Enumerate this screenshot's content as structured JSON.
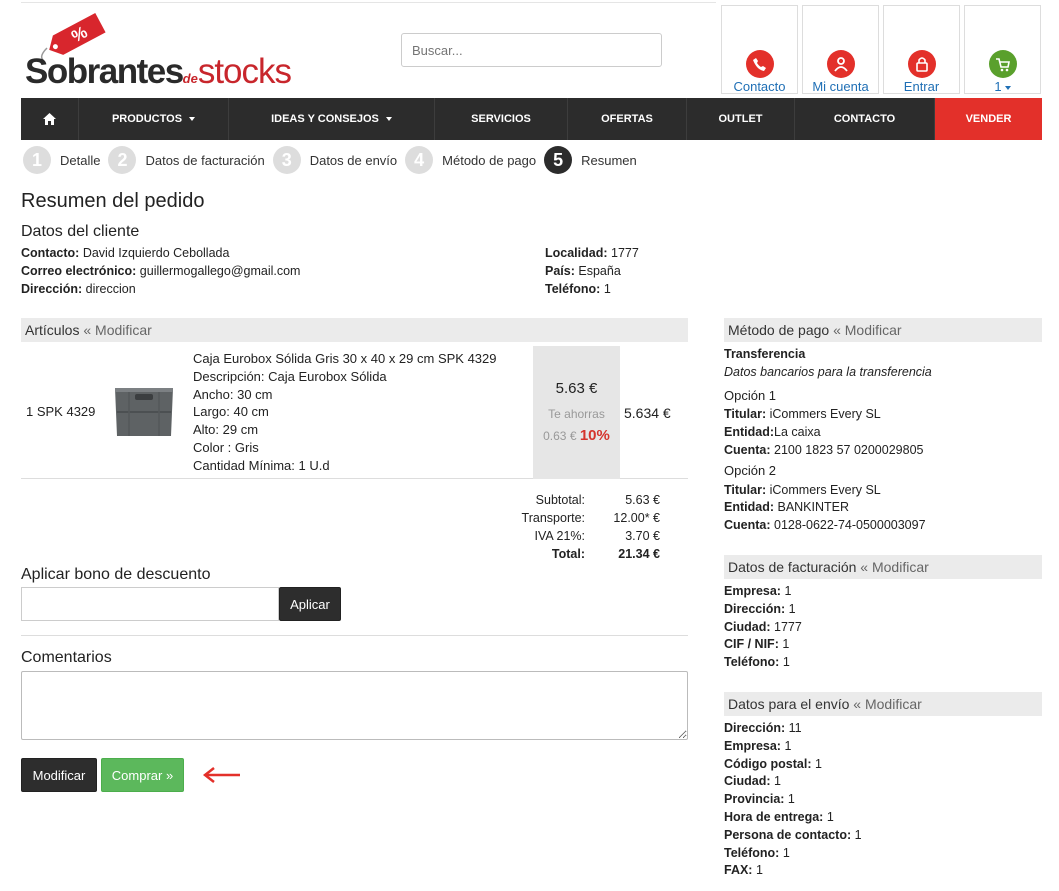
{
  "header": {
    "logo_text_main": "Sobrantes",
    "logo_text_de": "de",
    "logo_text_end": "stocks",
    "logo_tag_symbol": "%",
    "search_placeholder": "Buscar...",
    "quick_links": [
      {
        "label": "Contacto",
        "icon": "phone-icon",
        "color": "#e3302a"
      },
      {
        "label": "Mi cuenta",
        "icon": "user-icon",
        "color": "#e3302a"
      },
      {
        "label": "Entrar",
        "icon": "lock-icon",
        "color": "#e3302a"
      },
      {
        "label": "1",
        "icon": "cart-icon",
        "color": "#5aa02c"
      }
    ]
  },
  "nav": {
    "items": [
      "PRODUCTOS",
      "IDEAS Y CONSEJOS",
      "SERVICIOS",
      "OFERTAS",
      "OUTLET",
      "CONTACTO",
      "VENDER"
    ]
  },
  "steps": [
    {
      "num": "1",
      "label": "Detalle"
    },
    {
      "num": "2",
      "label": "Datos de facturación"
    },
    {
      "num": "3",
      "label": "Datos de envío"
    },
    {
      "num": "4",
      "label": "Método de pago"
    },
    {
      "num": "5",
      "label": "Resumen"
    }
  ],
  "page_title": "Resumen del pedido",
  "customer": {
    "heading": "Datos del cliente",
    "contacto_label": "Contacto:",
    "contacto": "David Izquierdo Cebollada",
    "correo_label": "Correo electrónico:",
    "correo": "guillermogallego@gmail.com",
    "direccion_label": "Dirección:",
    "direccion": "direccion",
    "localidad_label": "Localidad:",
    "localidad": "1777",
    "pais_label": "País:",
    "pais": "España",
    "telefono_label": "Teléfono:",
    "telefono": "1"
  },
  "articles": {
    "heading": "Artículos",
    "modify": "« Modificar",
    "item": {
      "qty_ref": "1  SPK 4329",
      "name": "Caja Eurobox Sólida Gris 30 x 40 x 29 cm SPK 4329",
      "descripcion": "Descripción: Caja Eurobox Sólida",
      "ancho": "Ancho: 30 cm",
      "largo": "Largo: 40 cm",
      "alto": "Alto: 29 cm",
      "color": "Color : Gris",
      "cantidad": "Cantidad Mínima: 1 U.d",
      "price": "5.63 €",
      "save_label": "Te ahorras",
      "save_amount": "0.63 €",
      "save_percent": "10%",
      "line_total": "5.634 €"
    }
  },
  "totals": [
    {
      "label": "Subtotal:",
      "value": "5.63 €"
    },
    {
      "label": "Transporte:",
      "value": "12.00* €"
    },
    {
      "label": "IVA 21%:",
      "value": "3.70 €"
    },
    {
      "label": "Total:",
      "value": "21.34 €"
    }
  ],
  "discount": {
    "heading": "Aplicar bono de descuento",
    "button": "Aplicar"
  },
  "comments": {
    "heading": "Comentarios"
  },
  "actions": {
    "modify": "Modificar",
    "buy": "Comprar »"
  },
  "payment": {
    "heading": "Método de pago",
    "modify": "« Modificar",
    "method": "Transferencia",
    "note": "Datos bancarios para la transferencia",
    "opcion1": "Opción 1",
    "titular_label": "Titular:",
    "titular1": "iCommers Every SL",
    "entidad_label": "Entidad:",
    "entidad1": "La caixa",
    "cuenta_label": "Cuenta:",
    "cuenta1": "2100 1823 57 0200029805",
    "opcion2": "Opción 2",
    "titular2": "iCommers Every SL",
    "entidad2": "BANKINTER",
    "cuenta2": "0128-0622-74-0500003097"
  },
  "billing": {
    "heading": "Datos de facturación",
    "modify": "« Modificar",
    "rows": [
      {
        "label": "Empresa:",
        "value": "1"
      },
      {
        "label": "Dirección:",
        "value": "1"
      },
      {
        "label": "Ciudad:",
        "value": "1777"
      },
      {
        "label": "CIF / NIF:",
        "value": "1"
      },
      {
        "label": "Teléfono:",
        "value": "1"
      }
    ]
  },
  "shipping": {
    "heading": "Datos para el envío",
    "modify": "« Modificar",
    "rows": [
      {
        "label": "Dirección:",
        "value": "11"
      },
      {
        "label": "Empresa:",
        "value": "1"
      },
      {
        "label": "Código postal:",
        "value": "1"
      },
      {
        "label": "Ciudad:",
        "value": "1"
      },
      {
        "label": "Provincia:",
        "value": "1"
      },
      {
        "label": "Hora de entrega:",
        "value": "1"
      },
      {
        "label": "Persona de contacto:",
        "value": "1"
      },
      {
        "label": "Teléfono:",
        "value": "1"
      },
      {
        "label": "FAX:",
        "value": "1"
      }
    ]
  }
}
